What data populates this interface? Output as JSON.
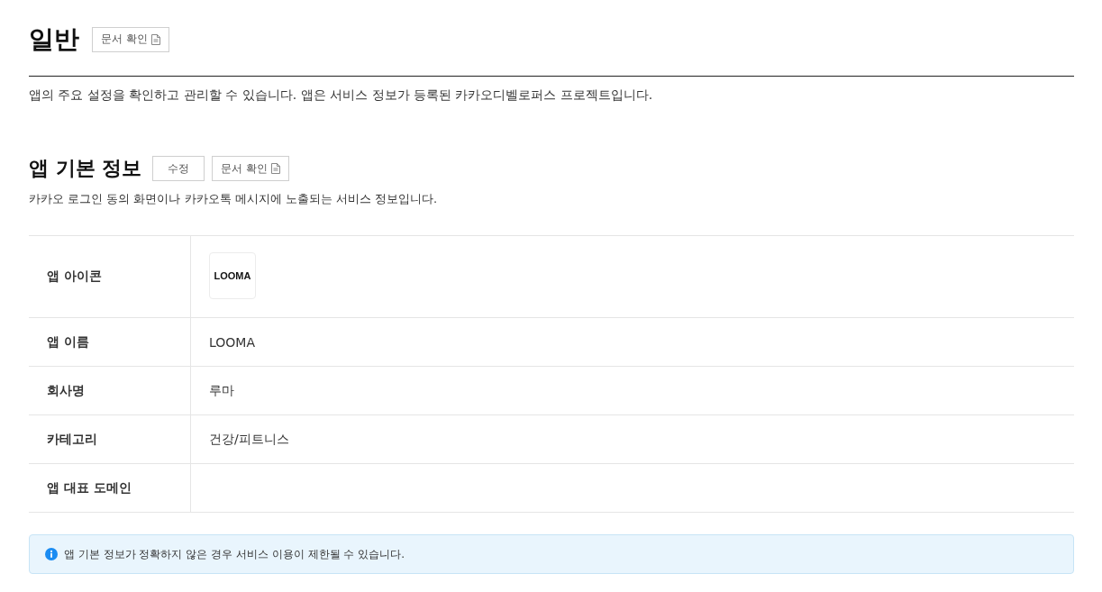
{
  "page": {
    "title": "일반",
    "doc_button": "문서 확인",
    "description": "앱의 주요 설정을 확인하고 관리할 수 있습니다. 앱은 서비스 정보가 등록된 카카오디벨로퍼스 프로젝트입니다."
  },
  "section": {
    "title": "앱 기본 정보",
    "buttons": [
      {
        "label": "수정",
        "kind": "plain"
      },
      {
        "label": "문서 확인",
        "kind": "doc"
      }
    ],
    "description": "카카오 로그인 동의 화면이나 카카오톡 메시지에 노출되는 서비스 정보입니다.",
    "rows": [
      {
        "label": "앱 아이콘",
        "kind": "logo",
        "value": "LOOMA"
      },
      {
        "label": "앱 이름",
        "kind": "text",
        "value": "LOOMA"
      },
      {
        "label": "회사명",
        "kind": "text",
        "value": "루마"
      },
      {
        "label": "카테고리",
        "kind": "text",
        "value": "건강/피트니스"
      },
      {
        "label": "앱 대표 도메인",
        "kind": "text"
      }
    ]
  },
  "notice": {
    "text": "앱 기본 정보가 정확하지 않은 경우 서비스 이용이 제한될 수 있습니다."
  }
}
